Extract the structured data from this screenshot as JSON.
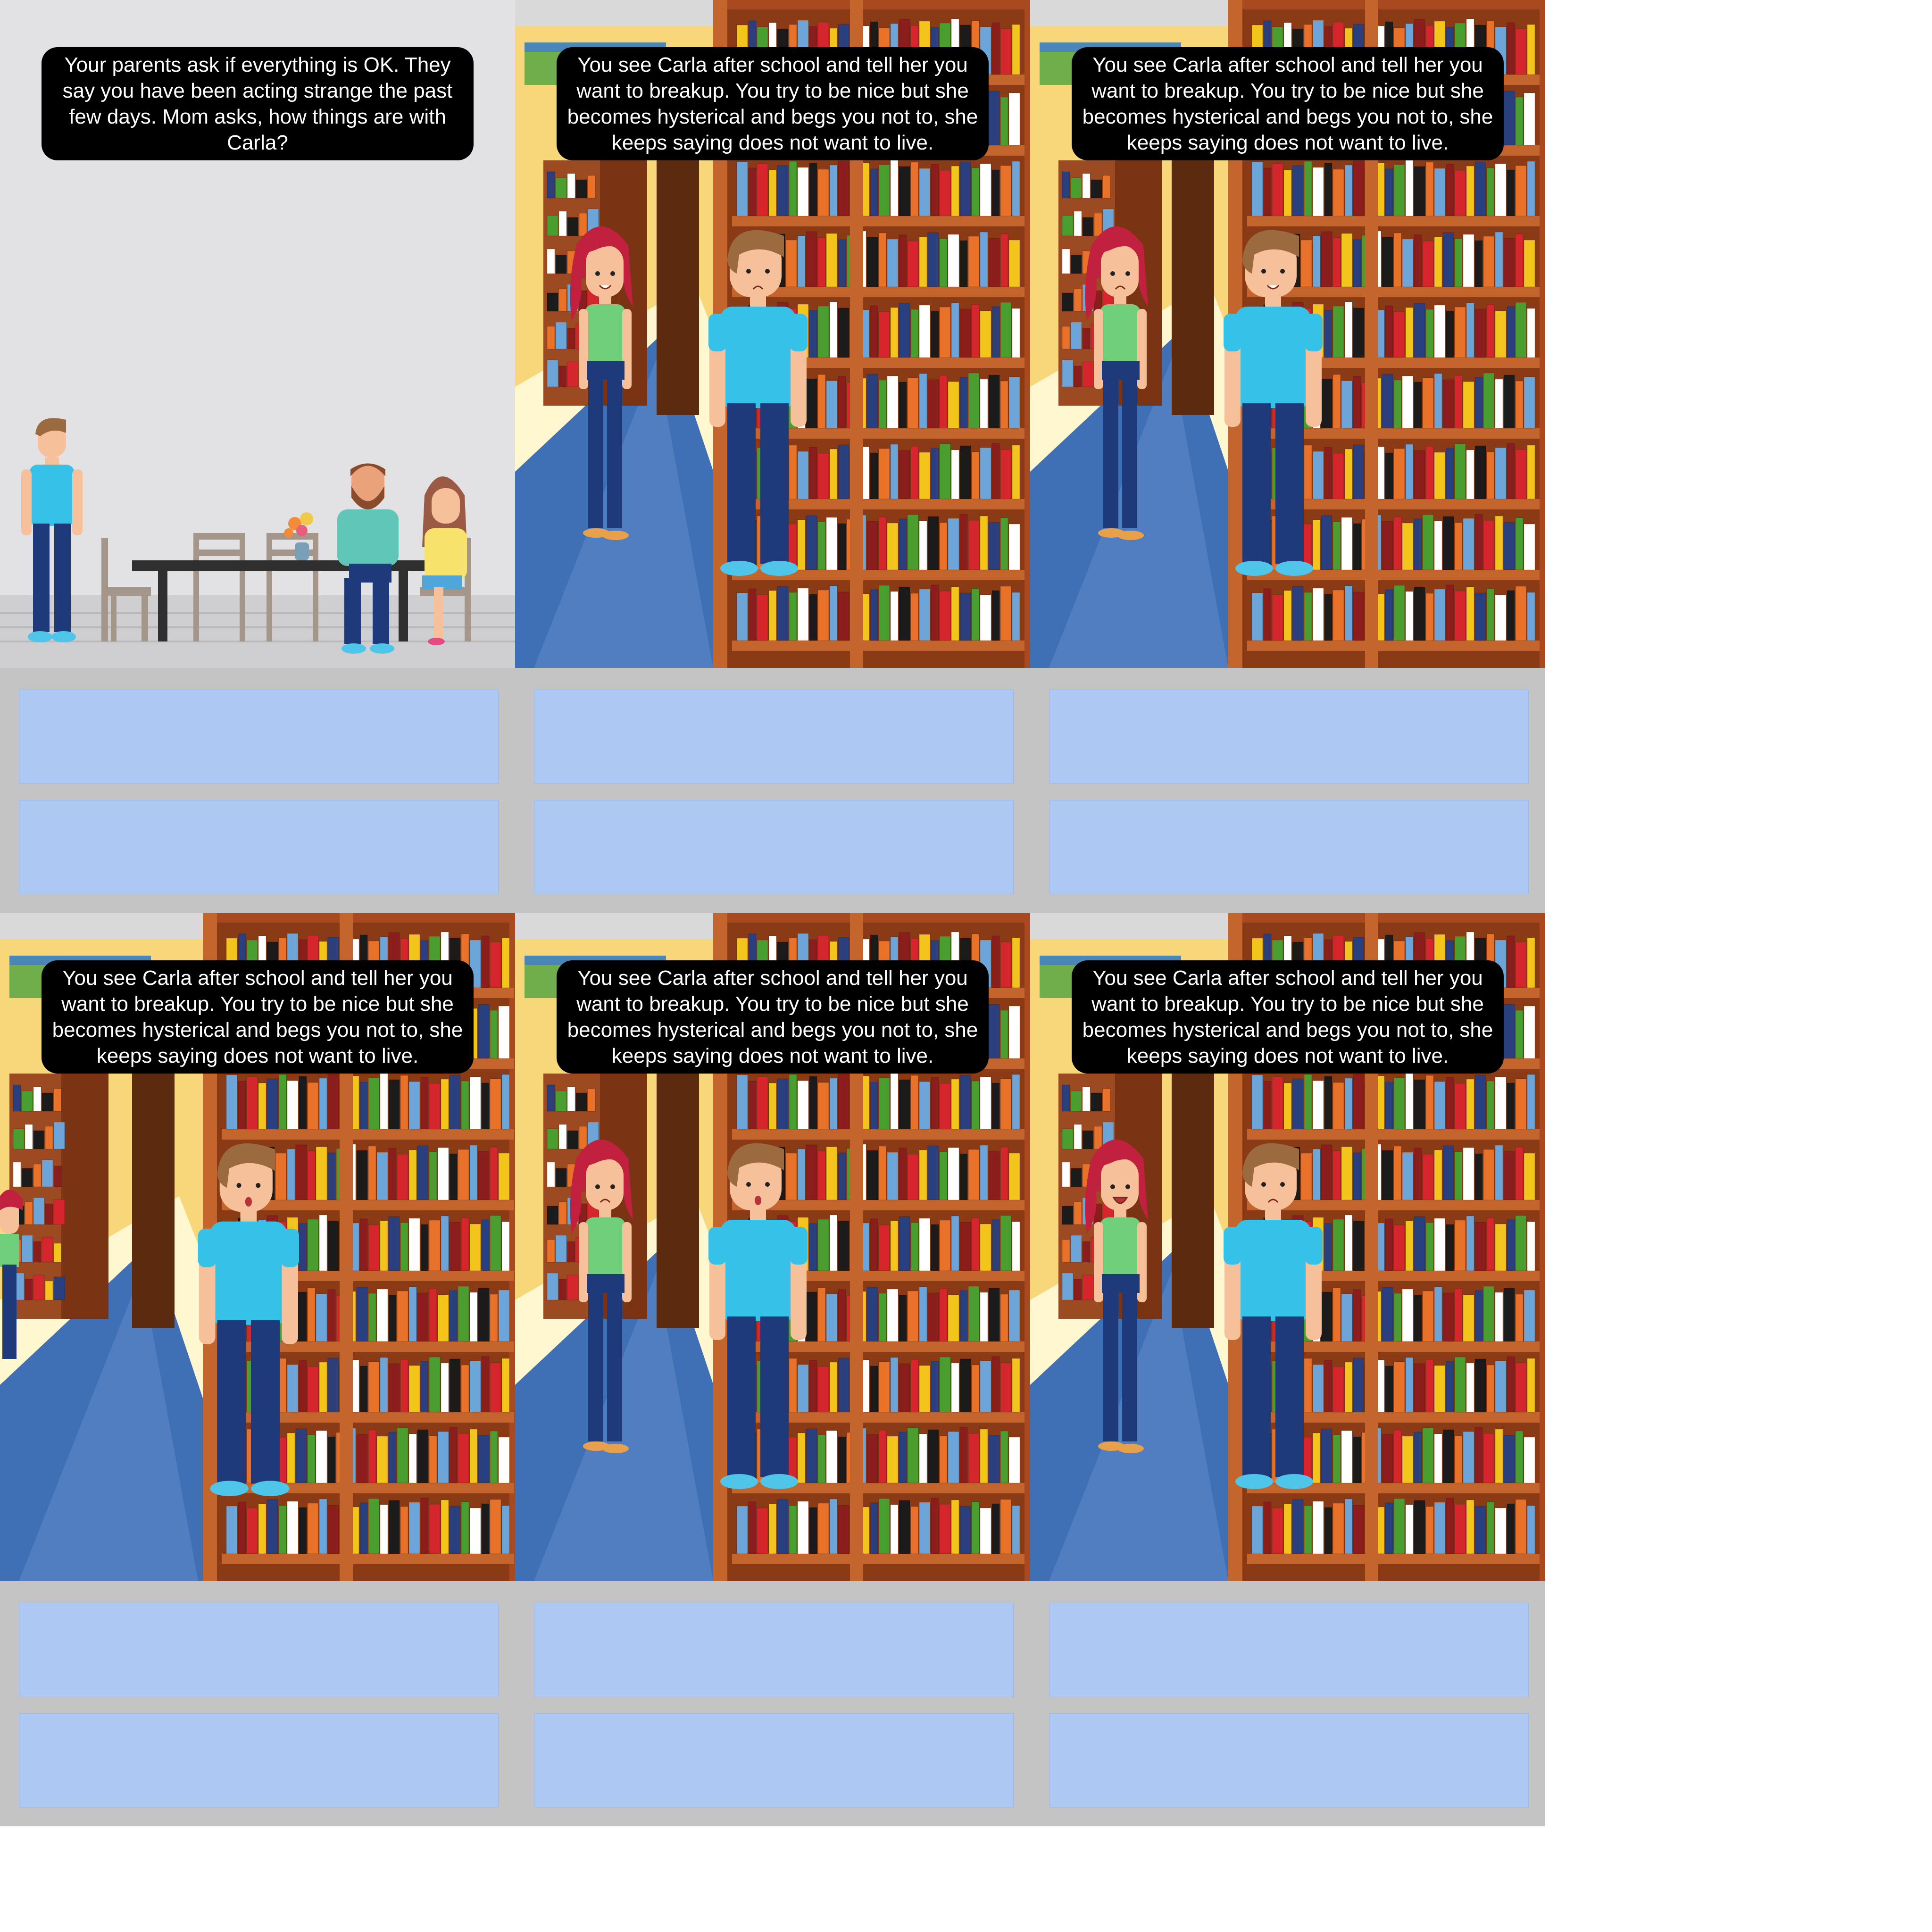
{
  "storyboard": {
    "cells": [
      {
        "id": "cell-1",
        "scene": "dining",
        "caption": "Your parents ask if everything is OK. They say you have been acting strange the past few days. Mom asks, how things are with Carla?"
      },
      {
        "id": "cell-2",
        "scene": "library",
        "caption": "You see Carla after school and tell her you want to breakup. You try to be nice but she becomes hysterical and begs you not to, she keeps saying does not want to live."
      },
      {
        "id": "cell-3",
        "scene": "library",
        "caption": "You see Carla after school and tell her you want to breakup. You try to be nice but she becomes hysterical and begs you not to, she keeps saying does not want to live."
      },
      {
        "id": "cell-4",
        "scene": "library",
        "caption": "You see Carla after school and tell her you want to breakup. You try to be nice but she becomes hysterical and begs you not to, she keeps saying does not want to live."
      },
      {
        "id": "cell-5",
        "scene": "library",
        "caption": "You see Carla after school and tell her you want to breakup. You try to be nice but she becomes hysterical and begs you not to, she keeps saying does not want to live."
      },
      {
        "id": "cell-6",
        "scene": "library",
        "caption": "You see Carla after school and tell her you want to breakup. You try to be nice but she becomes hysterical and begs you not to, she keeps saying does not want to live."
      }
    ],
    "colors": {
      "note_box": "#adc8f3",
      "note_panel": "#c4c4c4",
      "caption_bg": "#000000",
      "shirt": "#35c1e8",
      "pants": "#1f3a7a",
      "carla_hair": "#c2203f",
      "carla_top": "#6fcf7a"
    }
  }
}
